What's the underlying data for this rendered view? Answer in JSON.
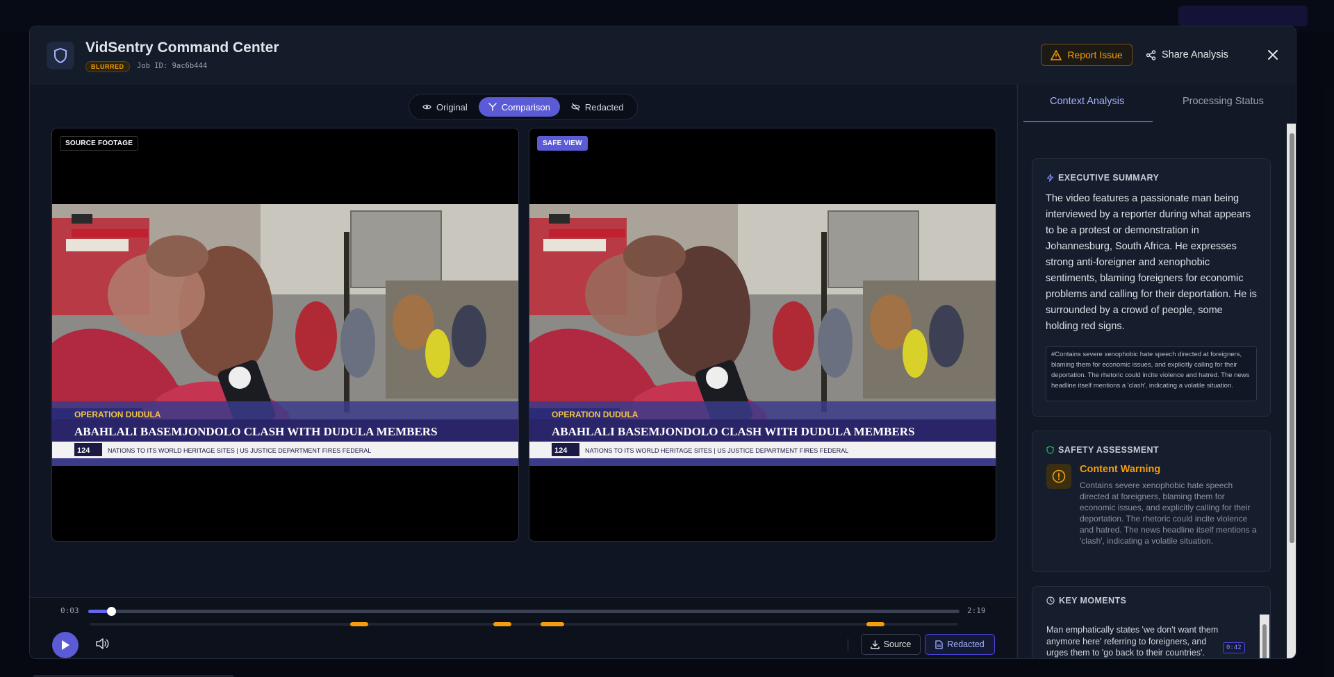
{
  "modal": {
    "title": "VidSentry Command Center",
    "status_badge": "BLURRED",
    "job_id": "Job ID: 9ac6b444",
    "report_label": "Report Issue",
    "share_label": "Share Analysis"
  },
  "view_toggle": {
    "original": "Original",
    "comparison": "Comparison",
    "redacted": "Redacted",
    "active": "Comparison"
  },
  "panes": {
    "source_label": "SOURCE FOOTAGE",
    "safe_label": "SAFE VIEW"
  },
  "video_frame": {
    "lower_third_tag": "OPERATION DUDULA",
    "headline": "ABAHLALI BASEMJONDOLO CLASH WITH DUDULA MEMBERS",
    "ticker": "NATIONS TO ITS WORLD HERITAGE SITES  |  US JUSTICE DEPARTMENT FIRES FEDERAL",
    "channel_number": "124"
  },
  "player": {
    "current_time": "0:03",
    "duration": "2:19",
    "progress": 0.026,
    "moment_markers": [
      0.31,
      0.475,
      0.53,
      0.905
    ],
    "source_label": "Source",
    "redacted_label": "Redacted"
  },
  "sidebar": {
    "tab_context": "Context Analysis",
    "tab_status": "Processing Status",
    "summary_heading": "EXECUTIVE SUMMARY",
    "summary_text": "The video features a passionate man being interviewed by a reporter during what appears to be a protest or demonstration in Johannesburg, South Africa. He expresses strong anti-foreigner and xenophobic sentiments, blaming foreigners for economic problems and calling for their deportation. He is surrounded by a crowd of people, some holding red signs.",
    "summary_note": "#Contains severe xenophobic hate speech directed at foreigners, blaming them for economic issues, and explicitly calling for their deportation. The rhetoric could incite violence and hatred. The news headline itself mentions a 'clash', indicating a volatile situation.",
    "safety_heading": "SAFETY ASSESSMENT",
    "warning_title": "Content Warning",
    "warning_text": "Contains severe xenophobic hate speech directed at foreigners, blaming them for economic issues, and explicitly calling for their deportation. The rhetoric could incite violence and hatred. The news headline itself mentions a 'clash', indicating a volatile situation.",
    "key_moments_heading": "KEY MOMENTS",
    "key_moments": [
      {
        "text": "Man emphatically states 'we don't want them anymore here' referring to foreigners, and urges them to 'go back to their countries'.",
        "time": "0:42"
      }
    ]
  },
  "colors": {
    "accent": "#5b5bd6",
    "warning": "#f59e0b"
  }
}
